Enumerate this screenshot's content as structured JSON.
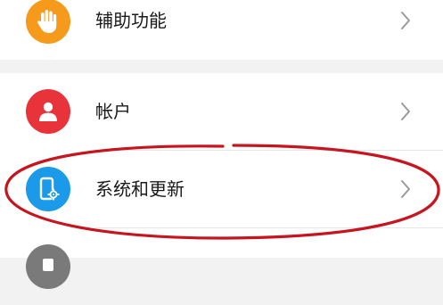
{
  "settings": {
    "items": [
      {
        "label": "辅助功能",
        "icon": "hand-icon",
        "color": "#f59a1b"
      },
      {
        "label": "帐户",
        "icon": "user-icon",
        "color": "#e8333b"
      },
      {
        "label": "系统和更新",
        "icon": "phone-settings-icon",
        "color": "#1a9ae8"
      },
      {
        "icon": "partial-icon",
        "color": "#7a7a7a"
      }
    ],
    "highlight_color": "#c6151e"
  }
}
